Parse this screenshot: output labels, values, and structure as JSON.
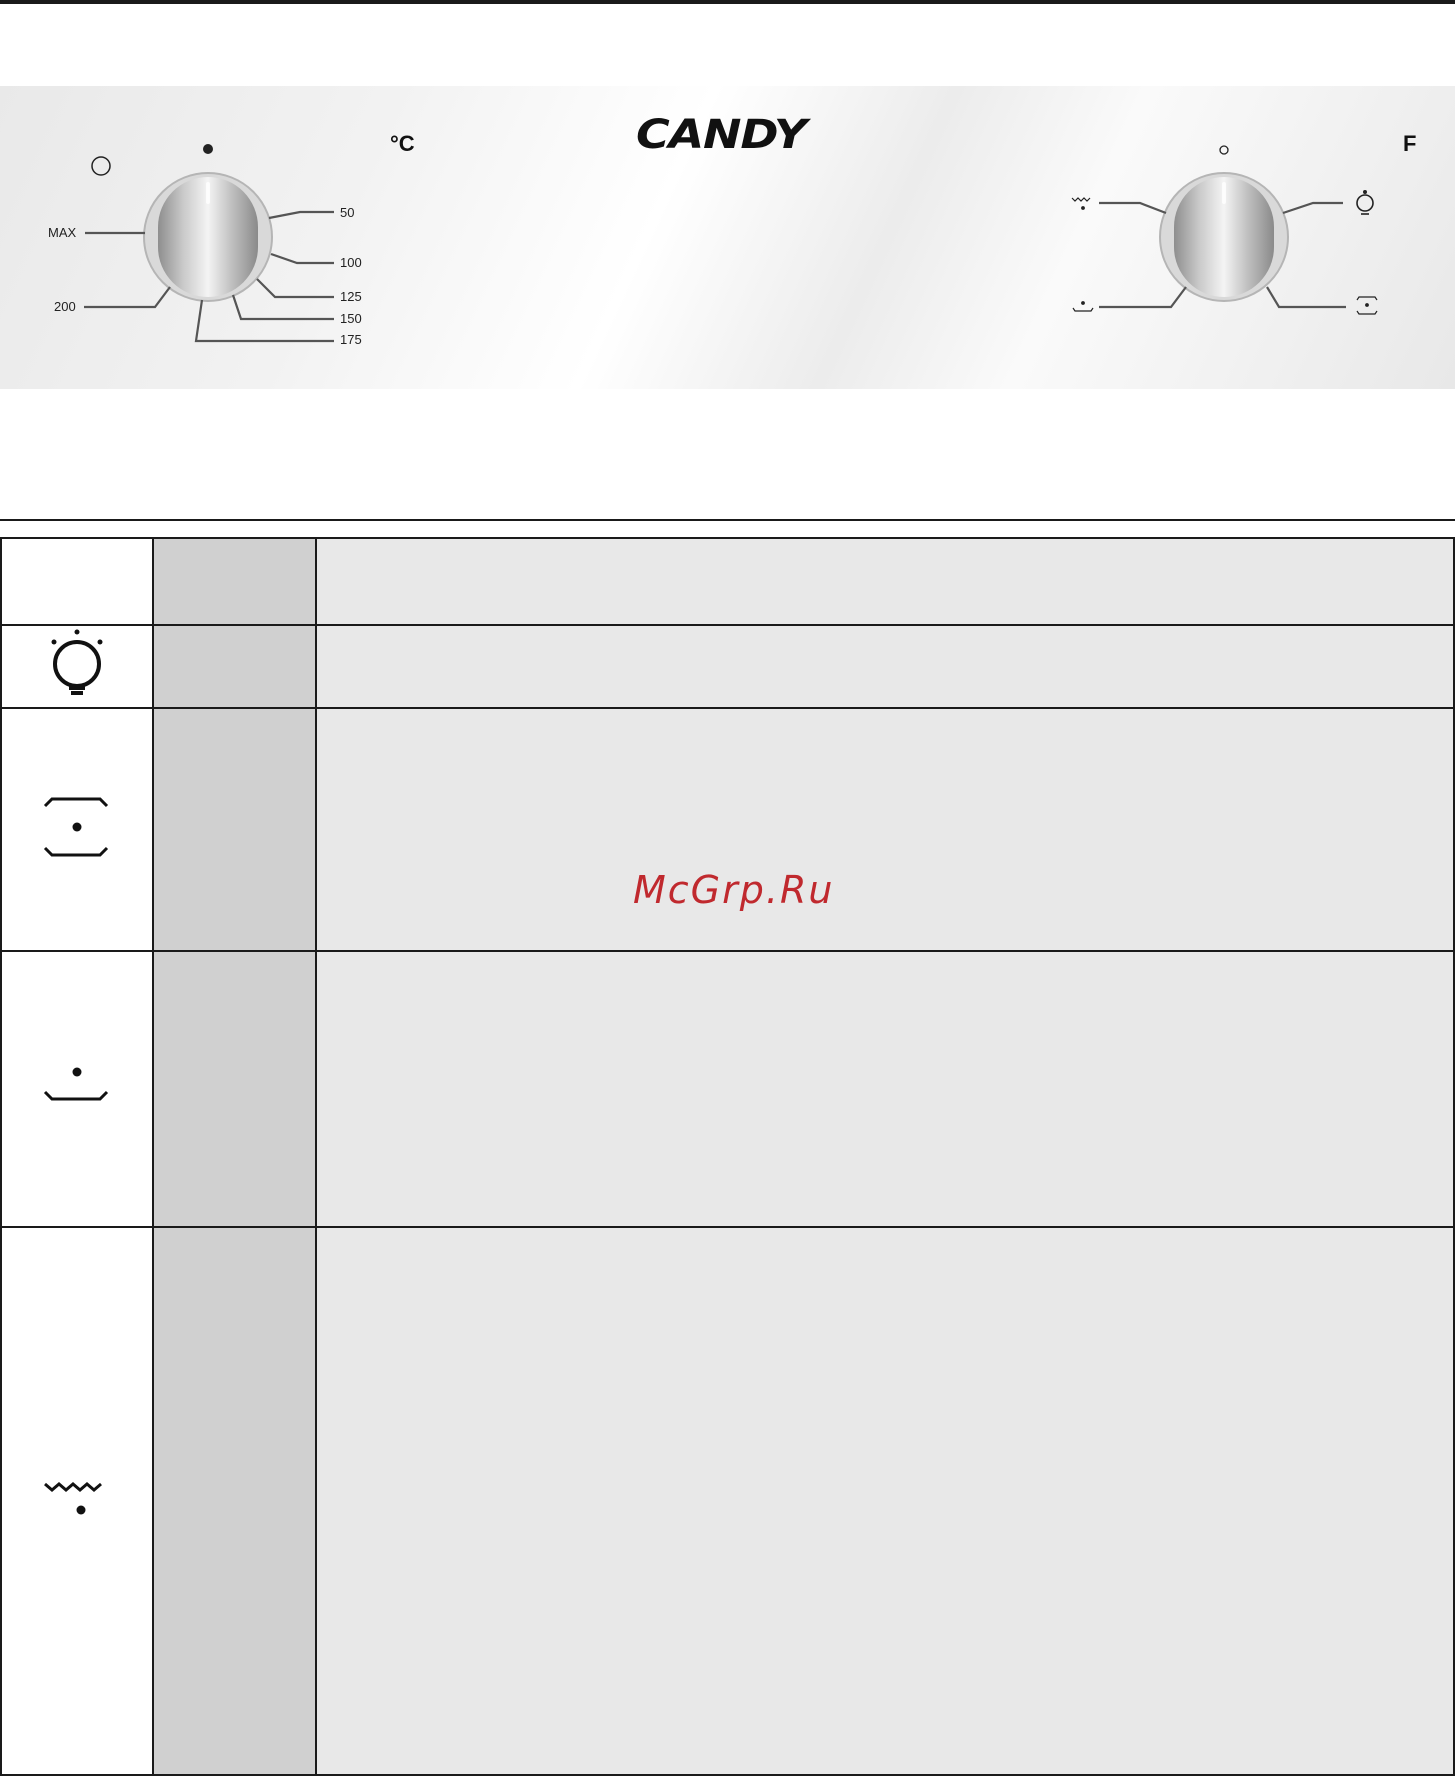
{
  "control_panel": {
    "thermostat": {
      "unit": "°C",
      "labels": [
        "MAX",
        "200",
        "50",
        "100",
        "125",
        "150",
        "175"
      ]
    },
    "brand": "CANDY",
    "function_selector": {
      "unit": "F",
      "positions": [
        "grill-icon",
        "lamp-icon",
        "bottom-heat-icon",
        "conventional-icon"
      ]
    }
  },
  "functions_table": {
    "rows": [
      {
        "icon": "blank"
      },
      {
        "icon": "lamp-icon"
      },
      {
        "icon": "top-bottom-heat-icon"
      },
      {
        "icon": "bottom-heat-icon"
      },
      {
        "icon": "grill-icon"
      }
    ]
  },
  "watermark": "McGrp.Ru"
}
